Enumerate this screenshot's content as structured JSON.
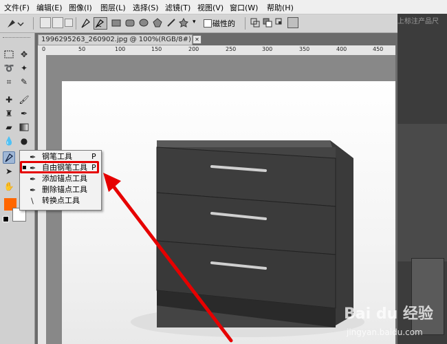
{
  "menu": {
    "items": [
      "文件(F)",
      "编辑(E)",
      "图像(I)",
      "图层(L)",
      "选择(S)",
      "滤镜(T)",
      "视图(V)",
      "窗口(W)",
      "帮助(H)"
    ]
  },
  "options_bar": {
    "magnetic_label": "磁性的"
  },
  "right_panel": {
    "partial_text": "上标注产品尺"
  },
  "document": {
    "tab_title": "1996295263_260902.jpg @ 100%(RGB/8#)",
    "ruler_labels": [
      "0",
      "50",
      "100",
      "150",
      "200",
      "250",
      "300",
      "350",
      "400",
      "450"
    ]
  },
  "flyout": {
    "items": [
      {
        "label": "钢笔工具",
        "shortcut": "P",
        "icon": "pen-icon",
        "selected": false
      },
      {
        "label": "自由钢笔工具",
        "shortcut": "P",
        "icon": "freeform-pen-icon",
        "selected": true
      },
      {
        "label": "添加锚点工具",
        "shortcut": "",
        "icon": "add-anchor-icon",
        "selected": false
      },
      {
        "label": "删除锚点工具",
        "shortcut": "",
        "icon": "delete-anchor-icon",
        "selected": false
      },
      {
        "label": "转换点工具",
        "shortcut": "",
        "icon": "convert-point-icon",
        "selected": false
      }
    ]
  },
  "watermark": {
    "brand": "Bai du 经验",
    "url": "jingyan.baidu.com"
  },
  "colors": {
    "foreground": "#ff6600",
    "background": "#ffffff",
    "highlight": "#e60000",
    "arrow": "#e60000"
  }
}
